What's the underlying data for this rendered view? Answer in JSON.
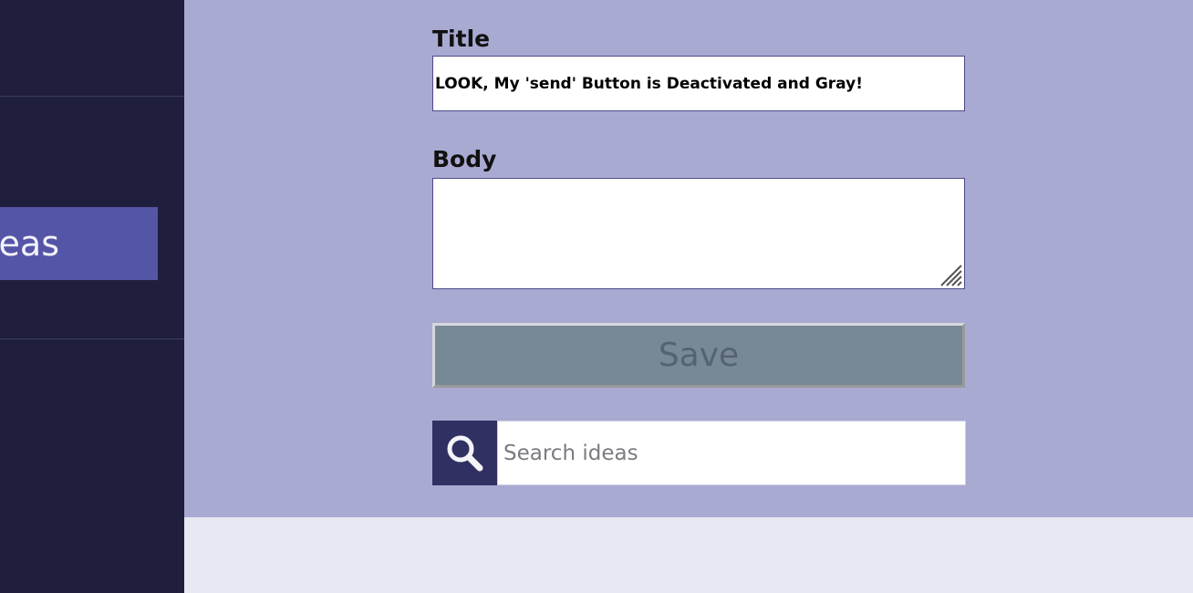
{
  "sidebar": {
    "active_item_label": "Ideas"
  },
  "form": {
    "title_label": "Title",
    "title_value": "LOOK, My 'send' Button is Deactivated and Gray!",
    "body_label": "Body",
    "body_value": "",
    "save_label": "Save",
    "save_enabled": false
  },
  "search": {
    "icon": "search-icon",
    "placeholder": "Search ideas"
  },
  "colors": {
    "sidebar_bg": "#1f1e3c",
    "sidebar_active_bg": "#5555a8",
    "panel_bg": "#a9aad2",
    "page_bg": "#e8e8f3",
    "save_disabled_bg": "#778896",
    "search_button_bg": "#313063"
  }
}
